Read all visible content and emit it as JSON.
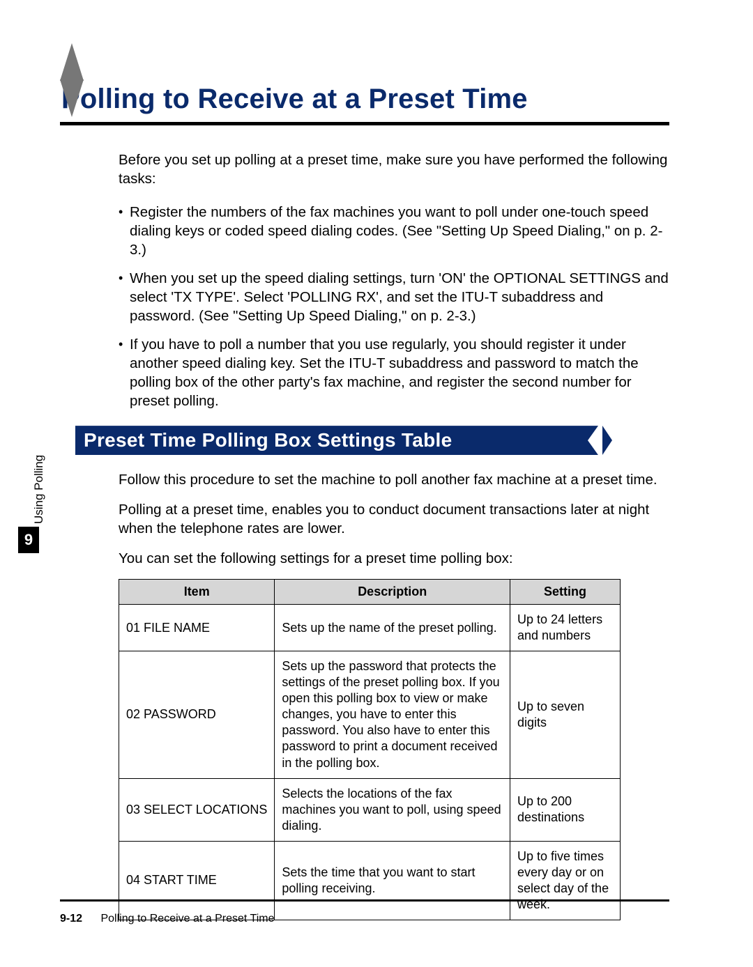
{
  "page": {
    "title": "Polling to Receive at a Preset Time",
    "intro": "Before you set up polling at a preset time, make sure you have performed the following tasks:",
    "bullets": [
      "Register the numbers of the fax machines you want to poll under one-touch speed dialing keys or coded speed dialing codes.\n(See \"Setting Up Speed Dialing,\" on p. 2-3.)",
      "When you set up the speed dialing settings, turn 'ON' the OPTIONAL SETTINGS and select 'TX TYPE'. Select 'POLLING RX', and set the ITU-T subaddress and password. (See \"Setting Up Speed Dialing,\" on p. 2-3.)",
      "If you have to poll a number that you use regularly, you should register it under another speed dialing key. Set the ITU-T subaddress and password to match the polling box of the other party's fax machine, and register the second number for preset polling."
    ],
    "section_title": "Preset Time Polling Box Settings Table",
    "section_body": [
      "Follow this procedure to set the machine to poll another fax machine at a preset time.",
      "Polling at a preset time, enables you to conduct document transactions later at night when the telephone rates are lower.",
      "You can set the following settings for a preset time polling box:"
    ],
    "side": {
      "chapter": "9",
      "label": "Using Polling"
    },
    "table": {
      "headers": {
        "item": "Item",
        "desc": "Description",
        "setting": "Setting"
      },
      "rows": [
        {
          "item": "01 FILE NAME",
          "desc": "Sets up the name of the preset polling.",
          "setting": "Up to 24 letters and numbers"
        },
        {
          "item": "02 PASSWORD",
          "desc": "Sets up the password that protects the settings of the preset polling box. If you open this polling box to view or make changes, you have to enter this password. You also have to enter this password to print a document received in the polling box.",
          "setting": "Up to seven digits"
        },
        {
          "item": "03 SELECT LOCATIONS",
          "desc": "Selects the locations of the fax machines you want to poll, using speed dialing.",
          "setting": "Up to 200 destinations"
        },
        {
          "item": "04 START TIME",
          "desc": "Sets the time that you want to start polling receiving.",
          "setting": "Up to five times every day or on select day of the week."
        }
      ]
    },
    "footer": {
      "page_num": "9-12",
      "title": "Polling to Receive at a Preset Time"
    }
  }
}
